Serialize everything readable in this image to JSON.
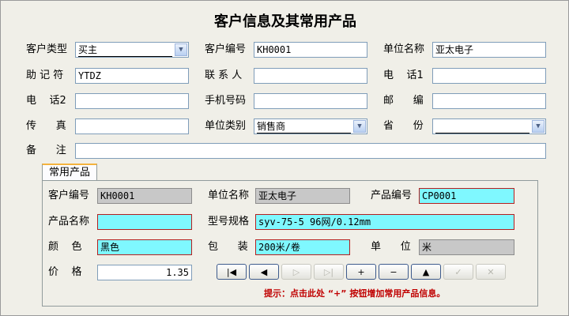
{
  "window_title": "客户信息及其常用产品",
  "form": {
    "customer_type_label": "客户类型",
    "customer_type_value": "买主",
    "customer_no_label": "客户编号",
    "customer_no_value": "KH0001",
    "company_name_label": "单位名称",
    "company_name_value": "亚太电子",
    "mnemonic_label": "助 记 符",
    "mnemonic_value": "YTDZ",
    "contact_label": "联 系 人",
    "contact_value": "",
    "phone1_label": "电    话1",
    "phone1_value": "",
    "phone2_label": "电    话2",
    "phone2_value": "",
    "mobile_label": "手机号码",
    "mobile_value": "",
    "postcode_label": "邮      编",
    "postcode_value": "",
    "fax_label": "传      真",
    "fax_value": "",
    "company_type_label": "单位类别",
    "company_type_value": "销售商",
    "province_label": "省      份",
    "province_value": "",
    "remark_label": "备      注",
    "remark_value": ""
  },
  "tab": {
    "label": "常用产品"
  },
  "product": {
    "customer_no_label": "客户编号",
    "customer_no_value": "KH0001",
    "company_name_label": "单位名称",
    "company_name_value": "亚太电子",
    "product_no_label": "产品编号",
    "product_no_value": "CP0001",
    "product_name_label": "产品名称",
    "product_name_value": "",
    "model_label": "型号规格",
    "model_value": "syv-75-5 96网/0.12mm",
    "color_label": "颜    色",
    "color_value": "黑色",
    "package_label": "包      装",
    "package_value": "200米/卷",
    "unit_label": "单      位",
    "unit_value": "米",
    "price_label": "价    格",
    "price_value": "1.35"
  },
  "nav": {
    "first": "|◀",
    "prev": "◀",
    "next": "▷",
    "last": "▷|",
    "add": "+",
    "delete": "−",
    "up": "▲",
    "confirm": "✓",
    "cancel": "✕"
  },
  "hint": "提示：点击此处 “+” 按钮增加常用产品信息。",
  "icons": {
    "dropdown": "▼"
  }
}
